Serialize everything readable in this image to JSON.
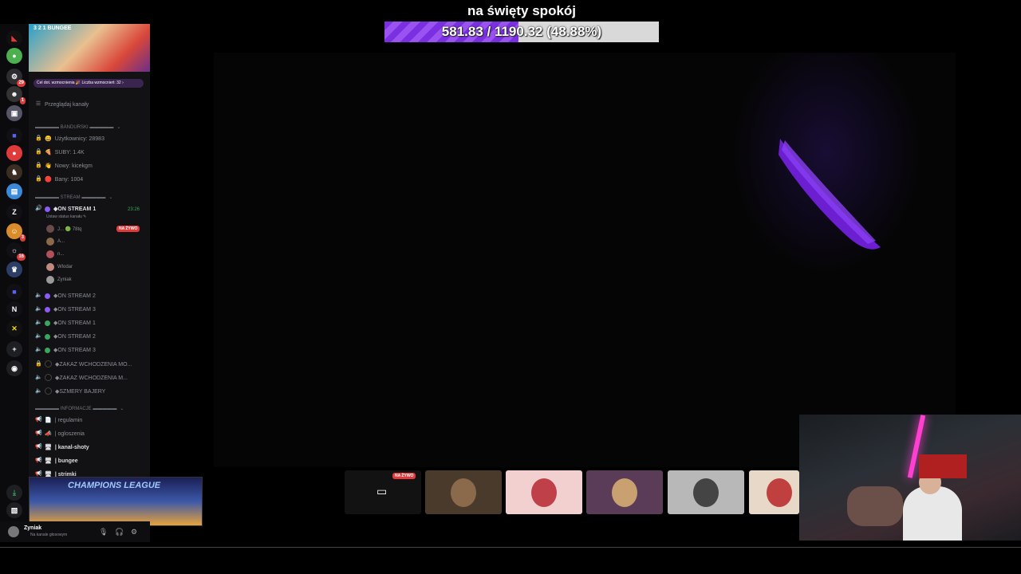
{
  "overlay": {
    "title": "na święty spokój",
    "progress_text": "581.83 / 1190.32 (48.88%)",
    "progress_fraction": 0.4888,
    "progress_color": "#8a3ff0"
  },
  "server": {
    "name": "3 2 1 BUNGEE",
    "boost_text": "Cel dot. wzmocnienia 🎉 Liczba wzmocnień: 32 ›",
    "browse_channels": "Przeglądaj kanały"
  },
  "rail": {
    "badges": [
      "29",
      "1",
      "3",
      "16"
    ],
    "letters": [
      "Z",
      "N"
    ]
  },
  "categories": {
    "bandurski": "▬▬▬▬▬ BANDURSKI ▬▬▬▬▬",
    "stream": "▬▬▬▬▬ STREAM ▬▬▬▬▬",
    "informacje": "▬▬▬▬▬ INFORMACJE ▬▬▬▬▬"
  },
  "stats": [
    {
      "emoji": "😀",
      "text": "Użytkownicy: 28983"
    },
    {
      "emoji": "🍕",
      "text": "SUBY: 1.4K"
    },
    {
      "emoji": "👋",
      "text": "Nowy: kicekgm"
    },
    {
      "emoji": "🛑",
      "text": "Bany: 1004"
    }
  ],
  "active_voice": {
    "name": "◆ON STREAM 1",
    "status": "Ustaw status kanału ✎",
    "time": "23:26",
    "live_badge": "NA ŻYWO",
    "members": [
      "J...  🟢 78tq",
      "A...",
      "n...",
      "Wlodar",
      "Zyniak"
    ]
  },
  "voice_channels": [
    {
      "name": "◆ON STREAM 2",
      "dot": "#8a5cf5"
    },
    {
      "name": "◆ON STREAM 3",
      "dot": "#8a5cf5"
    },
    {
      "name": "◆ON STREAM 1",
      "dot": "#3ba55d"
    },
    {
      "name": "◆ON STREAM 2",
      "dot": "#3ba55d"
    },
    {
      "name": "◆ON STREAM 3",
      "dot": "#3ba55d"
    },
    {
      "name": "◆ZAKAZ WCHODZENIA MO...",
      "dot": "#111111"
    },
    {
      "name": "◆ZAKAZ WCHODZENIA M...",
      "dot": "#111111"
    },
    {
      "name": "◆SZMERY BAJERY",
      "dot": "#111111"
    }
  ],
  "text_channels": [
    {
      "name": "| regulamin",
      "bold": false
    },
    {
      "name": "| ogloszenia",
      "bold": false
    },
    {
      "name": "| kanal-shoty",
      "bold": true
    },
    {
      "name": "| bungee",
      "bold": true
    },
    {
      "name": "| strimki",
      "bold": true
    }
  ],
  "overlay_banner": {
    "text": "CHAMPIONS LEAGUE"
  },
  "user": {
    "name": "Zyniak",
    "status": "Na kanale głosowym"
  },
  "stage_tiles": {
    "live_badge": "NA ŻYWO",
    "tiles": [
      {
        "name": "screen-share",
        "bg": "#121212"
      },
      {
        "name": "user-1",
        "bg": "#4a3a2c"
      },
      {
        "name": "user-2",
        "bg": "#f2d0d0"
      },
      {
        "name": "user-3",
        "bg": "#5a3c58"
      },
      {
        "name": "user-4",
        "bg": "#b8b8b8"
      },
      {
        "name": "user-5",
        "bg": "#e8d8c8"
      }
    ]
  }
}
